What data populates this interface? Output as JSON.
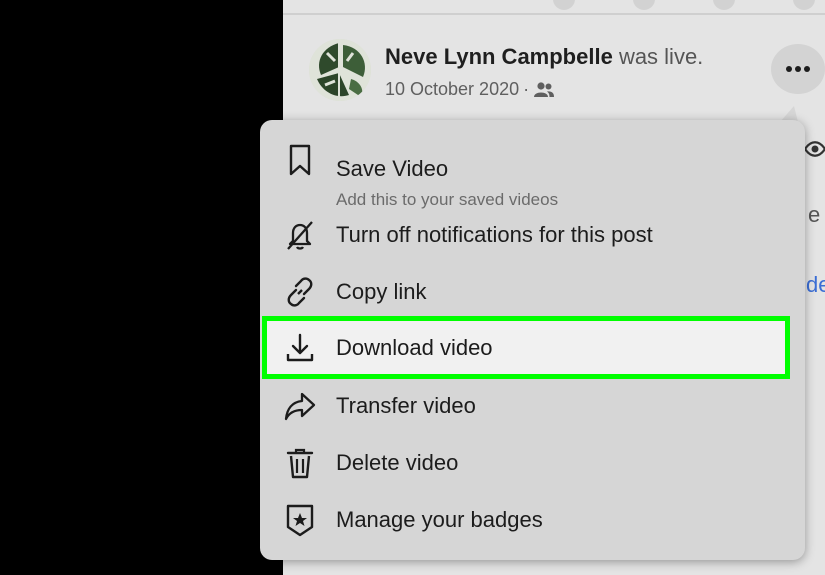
{
  "post": {
    "author_name": "Neve Lynn Campbelle",
    "author_suffix": "was live.",
    "date": "10 October 2020",
    "meta_separator": "·"
  },
  "right_peek": {
    "text_1": "e",
    "text_2": "de"
  },
  "menu": {
    "items": [
      {
        "label": "Save Video",
        "sublabel": "Add this to your saved videos",
        "icon": "bookmark-icon"
      },
      {
        "label": "Turn off notifications for this post",
        "icon": "bell-off-icon"
      },
      {
        "label": "Copy link",
        "icon": "link-icon"
      },
      {
        "label": "Download video",
        "icon": "download-icon",
        "highlighted": true
      },
      {
        "label": "Transfer video",
        "icon": "share-arrow-icon"
      },
      {
        "label": "Delete video",
        "icon": "trash-icon"
      },
      {
        "label": "Manage your badges",
        "icon": "badge-shield-icon"
      }
    ]
  },
  "colors": {
    "highlight_border": "#00ff00",
    "menu_background": "#d6d6d6",
    "link_text": "#3b6ed5"
  }
}
